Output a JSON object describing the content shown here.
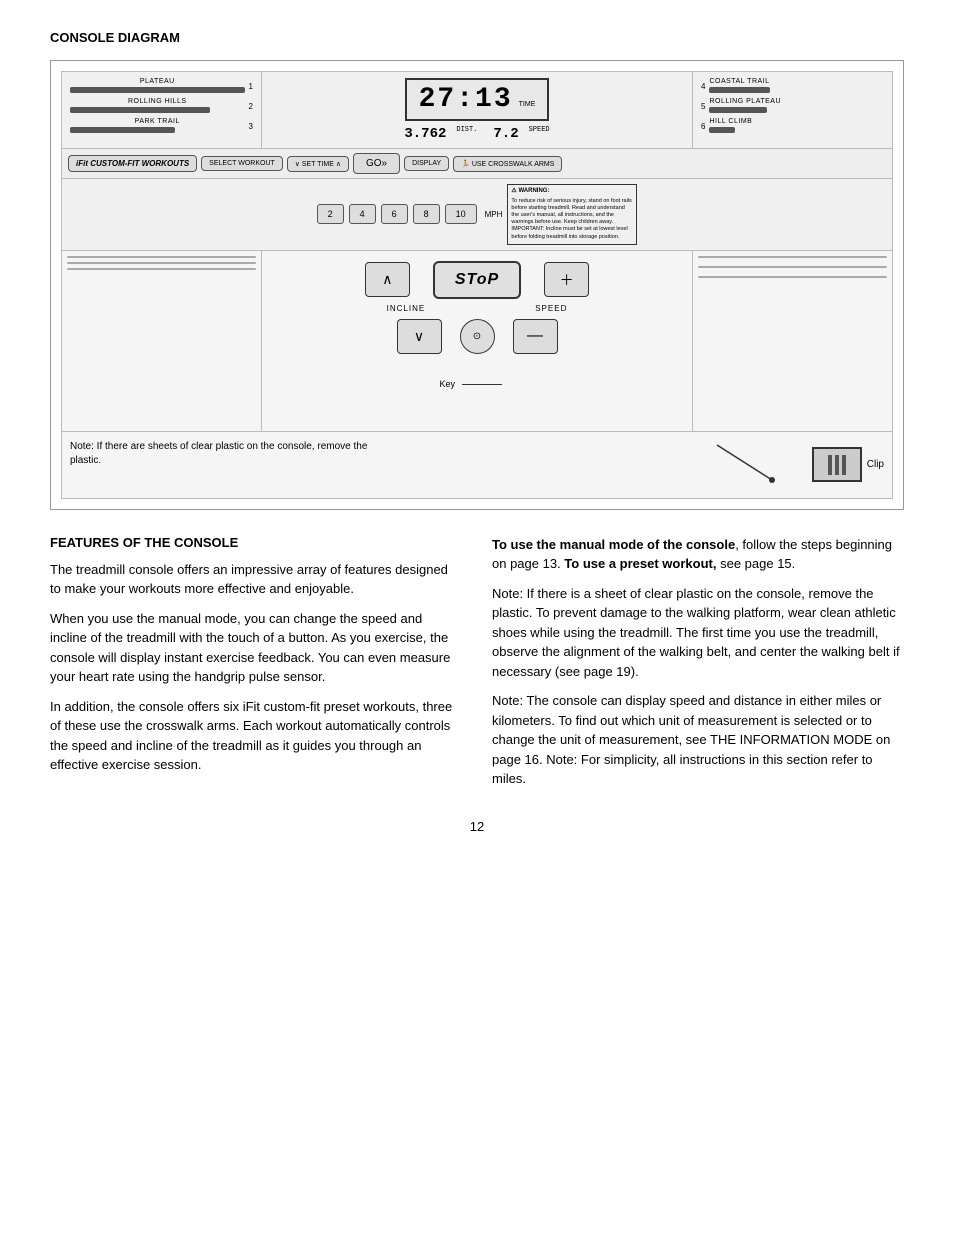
{
  "page": {
    "title": "CONSOLE DIAGRAM",
    "features_title": "FEATURES OF THE CONSOLE",
    "page_number": "12"
  },
  "diagram": {
    "left_workouts": [
      {
        "label": "PLATEAU",
        "number": "1"
      },
      {
        "label": "ROLLING HILLS",
        "number": "2"
      },
      {
        "label": "PARK TRAIL",
        "number": "3"
      }
    ],
    "right_workouts": [
      {
        "label": "COASTAL TRAIL",
        "number": "4"
      },
      {
        "label": "ROLLING PLATEAU",
        "number": "5"
      },
      {
        "label": "HILL CLIMB",
        "number": "6"
      }
    ],
    "display": {
      "time": "27:13",
      "time_label": "TIME",
      "dist_value": "3.762",
      "dist_label": "DIST.",
      "speed_value": "7.2",
      "speed_label": "SPEED"
    },
    "buttons": {
      "ifit": "iFit CUSTOM-FIT WORKOUTS",
      "select_workout": "SELECT WORKOUT",
      "set_time": "SET TIME",
      "go": "GO»",
      "display": "DISPLAY",
      "crosswalk": "USE CROSSWALK ARMS"
    },
    "speed_buttons": [
      "2",
      "4",
      "6",
      "8",
      "10"
    ],
    "mph": "MPH",
    "warning_title": "⚠ WARNING:",
    "warning_text": "To reduce risk of serious injury, stand on foot rails before starting treadmill. Read and understand the user's manual, all instructions, and the warnings before use. Keep children away. IMPORTANT: Incline must be set at lowest level before folding treadmill into storage position.",
    "controls": {
      "stop": "SToP",
      "incline": "INCLINE",
      "speed": "SPEED"
    },
    "key_label": "Key",
    "clip_label": "Clip",
    "note": "Note: If there are sheets of clear plastic on the console, remove the plastic."
  },
  "text": {
    "features_p1": "The treadmill console offers an impressive array of features designed to make your workouts more effective and enjoyable.",
    "features_p2": "When you use the manual mode, you can change the speed and incline of the treadmill with the touch of a button. As you exercise, the console will display instant exercise feedback. You can even measure your heart rate using the handgrip pulse sensor.",
    "features_p3": "In addition, the console offers six iFit custom-fit preset workouts, three of these use the crosswalk arms. Each workout automatically controls the speed and incline of the treadmill as it guides you through an effective exercise session.",
    "right_p1_bold": "To use the manual mode of the console",
    "right_p1_rest": ", follow the steps beginning on page 13. ",
    "right_p1_bold2": "To use a preset workout,",
    "right_p1_rest2": " see page 15.",
    "right_p2": "Note: If there is a sheet of clear plastic on the console, remove the plastic. To prevent damage to the walking platform, wear clean athletic shoes while using the treadmill. The first time you use the treadmill, observe the alignment of the walking belt, and center the walking belt if necessary (see page 19).",
    "right_p3": "Note: The console can display speed and distance in either miles or kilometers. To find out which unit of measurement is selected or to change the unit of measurement, see THE INFORMATION MODE on page 16. Note: For simplicity, all instructions in this section refer to miles."
  }
}
